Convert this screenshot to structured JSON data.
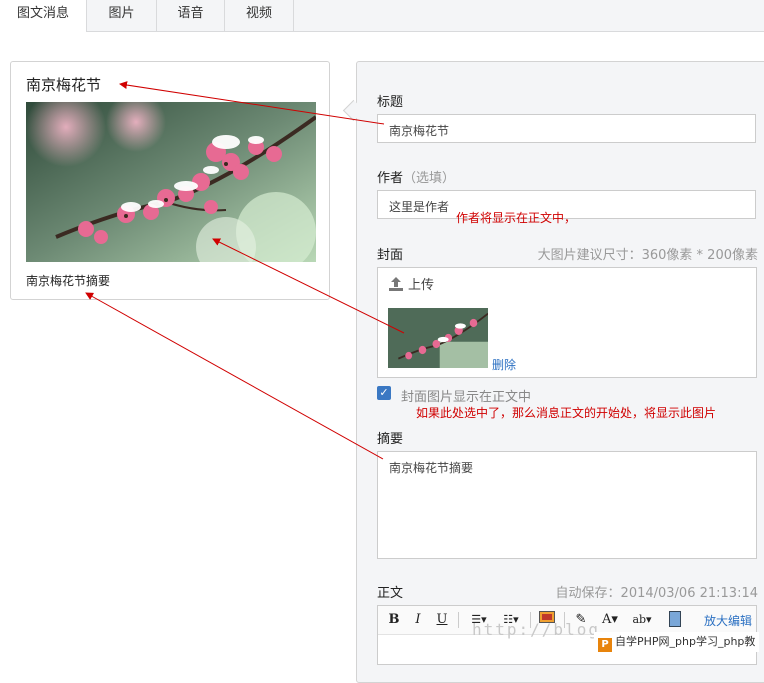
{
  "tabs": [
    {
      "label": "图文消息",
      "active": true
    },
    {
      "label": "图片",
      "active": false
    },
    {
      "label": "语音",
      "active": false
    },
    {
      "label": "视频",
      "active": false
    }
  ],
  "preview": {
    "title": "南京梅花节",
    "digest": "南京梅花节摘要"
  },
  "form": {
    "title_label": "标题",
    "title_value": "南京梅花节",
    "author_label": "作者",
    "author_optional": "（选填）",
    "author_value": "这里是作者",
    "cover_label": "封面",
    "cover_hint": "大图片建议尺寸：360像素 * 200像素",
    "upload_label": "上传",
    "delete_label": "删除",
    "show_cover_label": "封面图片显示在正文中",
    "show_cover_checked": true,
    "digest_label": "摘要",
    "digest_value": "南京梅花节摘要",
    "body_label": "正文",
    "autosave": "自动保存：2014/03/06 21:13:14",
    "zoom_edit": "放大编辑"
  },
  "annotations": {
    "author_note": "作者将显示在正文中，",
    "cover_note": "如果此处选中了，那么消息正文的开始处，将显示此图片"
  },
  "watermark": "http://blog.",
  "site_badge": "自学PHP网_php学习_php教",
  "colors": {
    "annotation": "#d00000",
    "link": "#2b70c2",
    "checkbox": "#3a78c3"
  }
}
